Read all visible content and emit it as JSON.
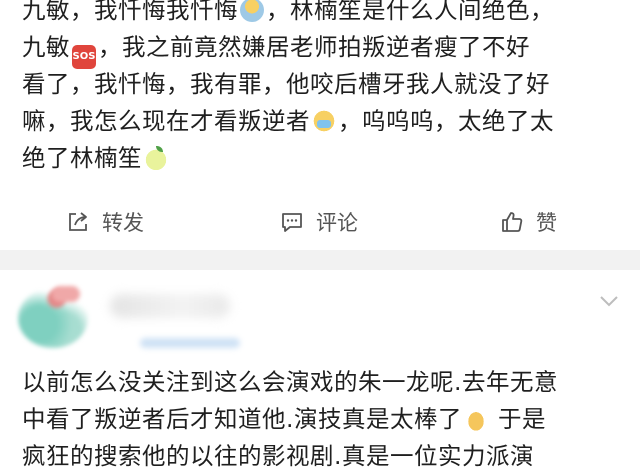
{
  "post": {
    "lines": [
      [
        "九敏，我忏悔我忏悔",
        "kneel-emoji",
        "，林楠笙是什么人间绝色，"
      ],
      [
        "九敏",
        "sos-emoji",
        "，我之前竟然嫌居老师拍叛逆者瘦了不好"
      ],
      [
        "看了，我忏悔，我有罪，他咬后槽牙我人就没了好"
      ],
      [
        "嘛，我怎么现在才看叛逆者",
        "crying-emoji",
        "，呜呜呜，太绝了太"
      ],
      [
        "绝了林楠笙",
        "pear-emoji",
        ""
      ]
    ],
    "sos_emoji_text": "SOS"
  },
  "actions": {
    "share_label": "转发",
    "comment_label": "评论",
    "like_label": "赞"
  },
  "comment": {
    "lines": [
      [
        "以前怎么没关注到这么会演戏的朱一龙呢.去年无意"
      ],
      [
        "中看了叛逆者后才知道他.演技真是太棒了",
        "thumbs-up-emoji",
        " 于是"
      ],
      [
        "疯狂的搜索他的以往的影视剧.真是一位实力派演"
      ]
    ]
  },
  "colors": {
    "text": "#1f1f1f",
    "action_text": "#555555",
    "separator": "#f2f2f2",
    "sos_red": "#e0453c"
  }
}
